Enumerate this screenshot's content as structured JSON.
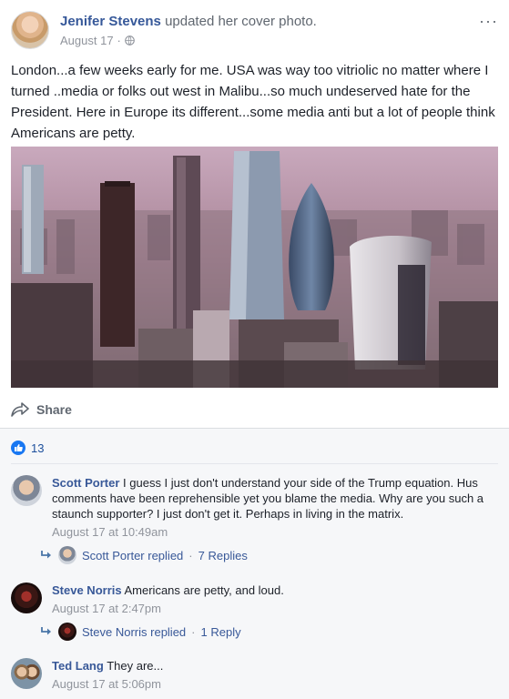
{
  "post": {
    "author": "Jenifer Stevens",
    "action": "updated her cover photo.",
    "date": "August 17",
    "dot": "·",
    "more": "···",
    "text": "London...a few weeks early for me. USA was way too vitriolic no matter where I turned ..media or folks out west in Malibu...so much undeserved hate for the President. Here in Europe its different...some media anti but a lot of people think Americans are petty.",
    "share_label": "Share",
    "like_count": "13"
  },
  "comments": [
    {
      "name": "Scott Porter",
      "text": "I guess I just don't understand your side of the Trump equation. Hus comments have been reprehensible yet you blame the media. Why are you such a staunch supporter? I just don't get it. Perhaps in living in the matrix.",
      "time": "August 17 at 10:49am",
      "reply_name": "Scott Porter replied",
      "reply_sep": "·",
      "reply_count": "7 Replies"
    },
    {
      "name": "Steve Norris",
      "text": "Americans are petty, and loud.",
      "time": "August 17 at 2:47pm",
      "reply_name": "Steve Norris replied",
      "reply_sep": "·",
      "reply_count": "1 Reply"
    },
    {
      "name": "Ted Lang",
      "text": "They are...",
      "time": "August 17 at 5:06pm"
    }
  ],
  "colors": {
    "link": "#365899",
    "like": "#1877f2",
    "muted": "#90949c"
  },
  "icons": [
    "globe-icon",
    "more-icon",
    "share-icon",
    "like-icon",
    "reply-arrow-icon"
  ]
}
